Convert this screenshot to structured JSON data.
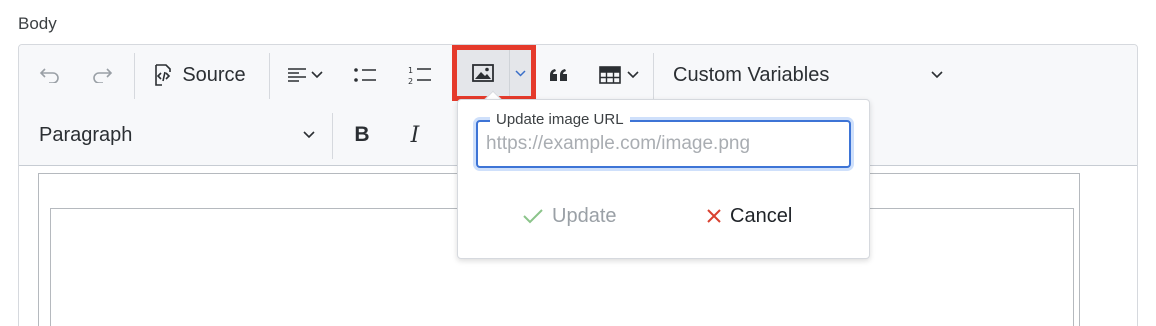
{
  "field": {
    "label": "Body"
  },
  "toolbar": {
    "undo_icon": "undo-icon",
    "redo_icon": "redo-icon",
    "source_label": "Source",
    "custom_variables_label": "Custom Variables",
    "paragraph_label": "Paragraph",
    "bold_label": "B",
    "italic_label": "I"
  },
  "image_popup": {
    "field_label": "Update image URL",
    "placeholder": "https://example.com/image.png",
    "value": "",
    "update_label": "Update",
    "cancel_label": "Cancel"
  },
  "colors": {
    "highlight": "#e53a2b",
    "focus": "#3d74d6",
    "update_check": "#8bc48a",
    "cancel_x": "#d9412f"
  }
}
